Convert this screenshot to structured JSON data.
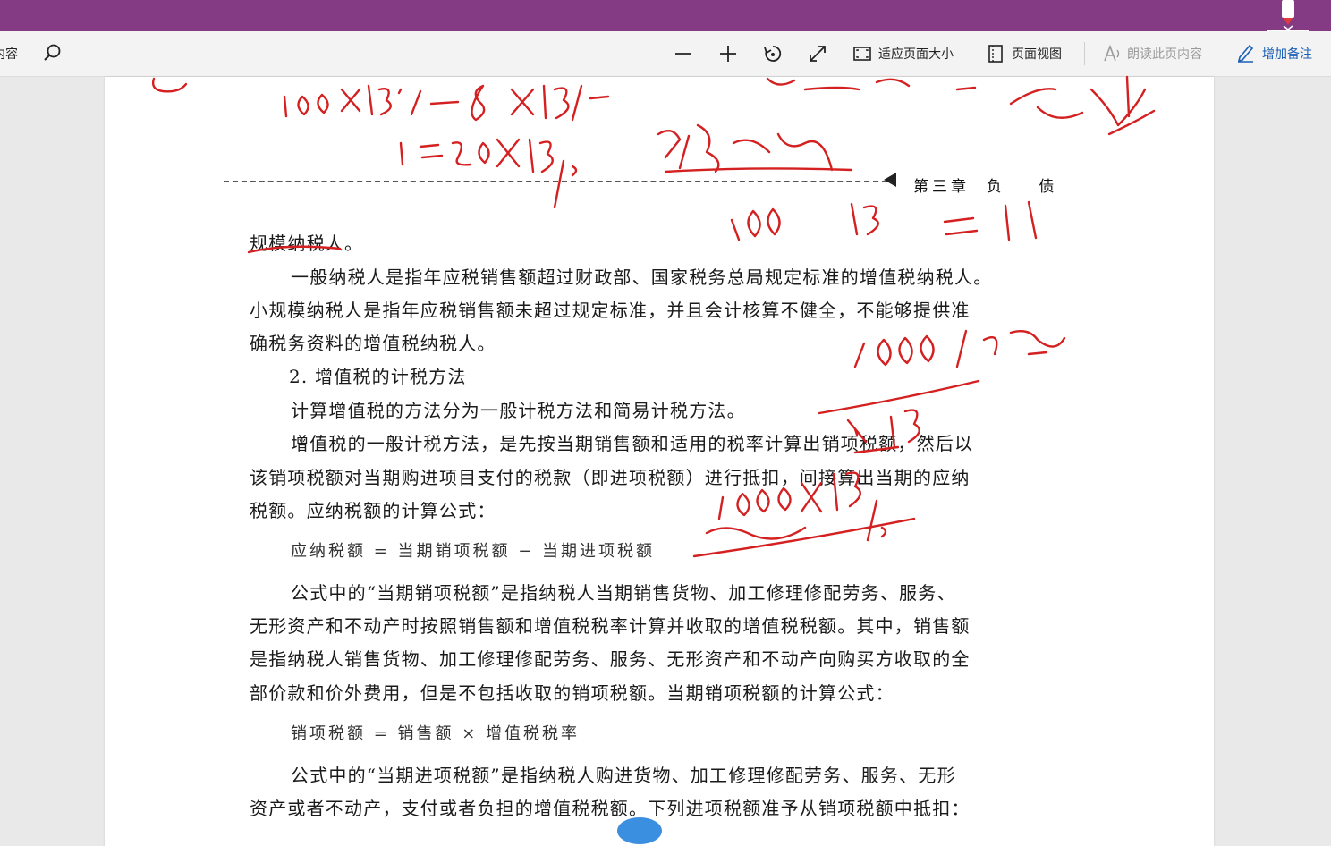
{
  "toolbar": {
    "partial_label": "内容",
    "fit_page_label": "适应页面大小",
    "page_view_label": "页面视图",
    "read_aloud_label": "朗读此页内容",
    "add_notes_label": "增加备注"
  },
  "document": {
    "running_header": "第三章  负    债",
    "lines": [
      "规模纳税人。",
      "一般纳税人是指年应税销售额超过财政部、国家税务总局规定标准的增值税纳税人。",
      "小规模纳税人是指年应税销售额未超过规定标准，并且会计核算不健全，不能够提供准",
      "确税务资料的增值税纳税人。",
      "2. 增值税的计税方法",
      "计算增值税的方法分为一般计税方法和简易计税方法。",
      "增值税的一般计税方法，是先按当期销售额和适用的税率计算出销项税额，然后以",
      "该销项税额对当期购进项目支付的税款（即进项税额）进行抵扣，间接算出当期的应纳",
      "税额。应纳税额的计算公式：",
      "应纳税额 = 当期销项税额 − 当期进项税额",
      "公式中的“当期销项税额”是指纳税人当期销售货物、加工修理修配劳务、服务、",
      "无形资产和不动产时按照销售额和增值税税率计算并收取的增值税税额。其中，销售额",
      "是指纳税人销售货物、加工修理修配劳务、服务、无形资产和不动产向购买方收取的全",
      "部价款和价外费用，但是不包括收取的销项税额。当期销项税额的计算公式：",
      "销项税额 = 销售额 × 增值税税率",
      "公式中的“当期进项税额”是指纳税人购进货物、加工修理修配劳务、服务、无形",
      "资产或者不动产，支付或者负担的增值税税额。下列进项税额准予从销项税额中抵扣："
    ]
  },
  "annotations": {
    "ink_color": "#d42020",
    "texts": [
      "100×13%－80×13%",
      "=20×13%",
      "税",
      "100",
      "13",
      "=11",
      "1000 含税",
      "1+13",
      "1000×13%"
    ]
  },
  "colors": {
    "title_bar": "#843b84",
    "toolbar_bg": "#f3f3f3",
    "accent": "#1a5fb4",
    "disabled": "#999999"
  },
  "icons": [
    "search-icon",
    "zoom-out-icon",
    "zoom-in-icon",
    "rotate-icon",
    "fullscreen-icon",
    "fit-page-icon",
    "page-view-icon",
    "read-aloud-icon",
    "add-notes-icon",
    "pen-icon"
  ]
}
